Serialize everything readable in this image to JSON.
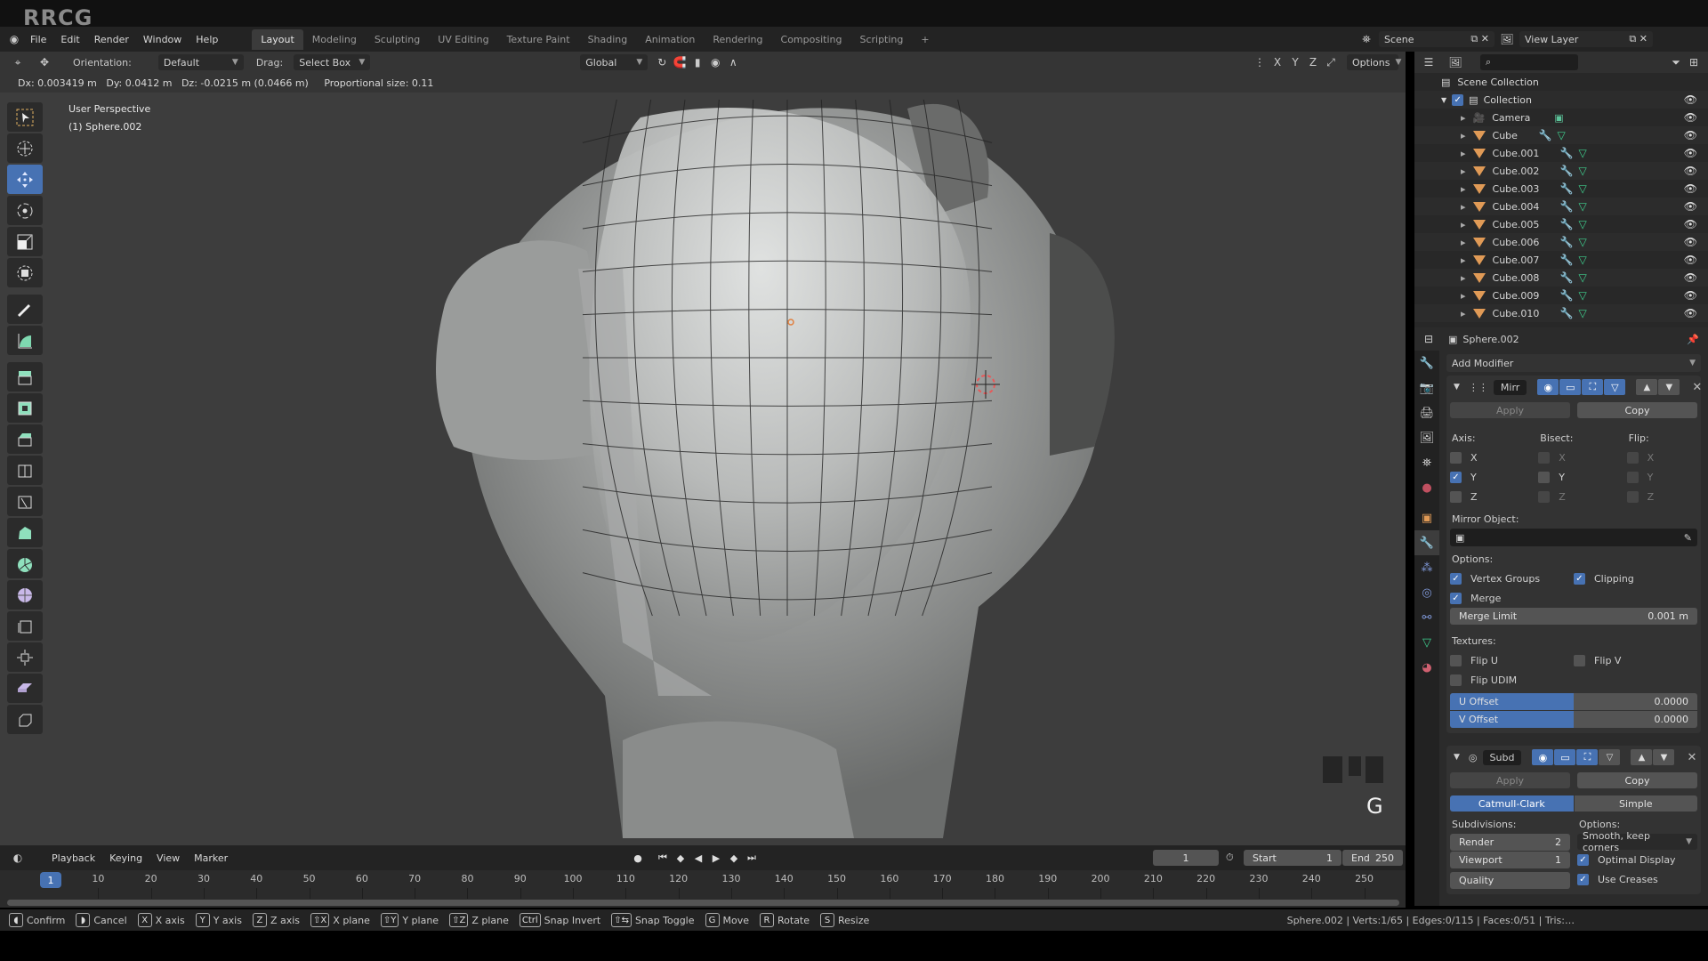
{
  "watermark": "RRCG",
  "menu": {
    "items": [
      "File",
      "Edit",
      "Render",
      "Window",
      "Help"
    ],
    "workspaces": [
      "Layout",
      "Modeling",
      "Sculpting",
      "UV Editing",
      "Texture Paint",
      "Shading",
      "Animation",
      "Rendering",
      "Compositing",
      "Scripting"
    ],
    "active_workspace": "Layout",
    "add_tab": "+",
    "scene_label": "Scene",
    "view_layer_label": "View Layer"
  },
  "header": {
    "orientation_label": "Orientation:",
    "orientation_value": "Default",
    "drag_label": "Drag:",
    "drag_value": "Select Box",
    "transform_orientation": "Global",
    "axis_x": "X",
    "axis_y": "Y",
    "axis_z": "Z",
    "options_label": "Options"
  },
  "viewport": {
    "status_text": "Dx: 0.003419 m   Dy: 0.0412 m   Dz: -0.0215 m (0.0466 m)     Proportional size: 0.11",
    "view_name": "User Perspective",
    "object_name": "(1) Sphere.002",
    "key_hint": "G"
  },
  "outliner": {
    "scene_collection": "Scene Collection",
    "collection": "Collection",
    "items": [
      {
        "name": "Camera",
        "type": "camera"
      },
      {
        "name": "Cube",
        "type": "mesh"
      },
      {
        "name": "Cube.001",
        "type": "mesh"
      },
      {
        "name": "Cube.002",
        "type": "mesh"
      },
      {
        "name": "Cube.003",
        "type": "mesh"
      },
      {
        "name": "Cube.004",
        "type": "mesh"
      },
      {
        "name": "Cube.005",
        "type": "mesh"
      },
      {
        "name": "Cube.006",
        "type": "mesh"
      },
      {
        "name": "Cube.007",
        "type": "mesh"
      },
      {
        "name": "Cube.008",
        "type": "mesh"
      },
      {
        "name": "Cube.009",
        "type": "mesh"
      },
      {
        "name": "Cube.010",
        "type": "mesh"
      }
    ]
  },
  "properties": {
    "object_name": "Sphere.002",
    "add_modifier": "Add Modifier",
    "mirror": {
      "name": "Mirr",
      "apply": "Apply",
      "copy": "Copy",
      "axis_label": "Axis:",
      "bisect_label": "Bisect:",
      "flip_label": "Flip:",
      "axes": [
        "X",
        "Y",
        "Z"
      ],
      "axis_checked": [
        false,
        true,
        false
      ],
      "mirror_object_label": "Mirror Object:",
      "options_label": "Options:",
      "vertex_groups": "Vertex Groups",
      "clipping": "Clipping",
      "merge": "Merge",
      "merge_limit_label": "Merge Limit",
      "merge_limit_value": "0.001 m",
      "textures_label": "Textures:",
      "flip_u": "Flip U",
      "flip_v": "Flip V",
      "flip_udim": "Flip UDIM",
      "u_offset_label": "U Offset",
      "u_offset_value": "0.0000",
      "v_offset_label": "V Offset",
      "v_offset_value": "0.0000"
    },
    "subdivision": {
      "name": "Subd",
      "apply": "Apply",
      "copy": "Copy",
      "catmull": "Catmull-Clark",
      "simple": "Simple",
      "subdivisions_label": "Subdivisions:",
      "options_label": "Options:",
      "render_label": "Render",
      "render_value": "2",
      "viewport_label": "Viewport",
      "viewport_value": "1",
      "quality_label": "Quality",
      "smooth_option": "Smooth, keep corners",
      "optimal_display": "Optimal Display",
      "use_creases": "Use Creases"
    }
  },
  "timeline": {
    "menus": [
      "Playback",
      "Keying",
      "View",
      "Marker"
    ],
    "current_frame": "1",
    "start_label": "Start",
    "start_value": "1",
    "end_label": "End",
    "end_value": "250",
    "ticks": [
      "10",
      "20",
      "30",
      "40",
      "50",
      "60",
      "70",
      "80",
      "90",
      "100",
      "110",
      "120",
      "130",
      "140",
      "150",
      "160",
      "170",
      "180",
      "190",
      "200",
      "210",
      "220",
      "230",
      "240",
      "250"
    ]
  },
  "statusbar": {
    "hints": [
      {
        "key": "◖",
        "label": "Confirm"
      },
      {
        "key": "◗",
        "label": "Cancel"
      },
      {
        "key": "X",
        "label": "X axis"
      },
      {
        "key": "Y",
        "label": "Y axis"
      },
      {
        "key": "Z",
        "label": "Z axis"
      },
      {
        "key": "⇧X",
        "label": "X plane"
      },
      {
        "key": "⇧Y",
        "label": "Y plane"
      },
      {
        "key": "⇧Z",
        "label": "Z plane"
      },
      {
        "key": "Ctrl",
        "label": "Snap Invert"
      },
      {
        "key": "⇧⇆",
        "label": "Snap Toggle"
      },
      {
        "key": "G",
        "label": "Move"
      },
      {
        "key": "R",
        "label": "Rotate"
      },
      {
        "key": "S",
        "label": "Resize"
      }
    ],
    "stats": "Sphere.002 | Verts:1/65 | Edges:0/115 | Faces:0/51 | Tris:…"
  }
}
